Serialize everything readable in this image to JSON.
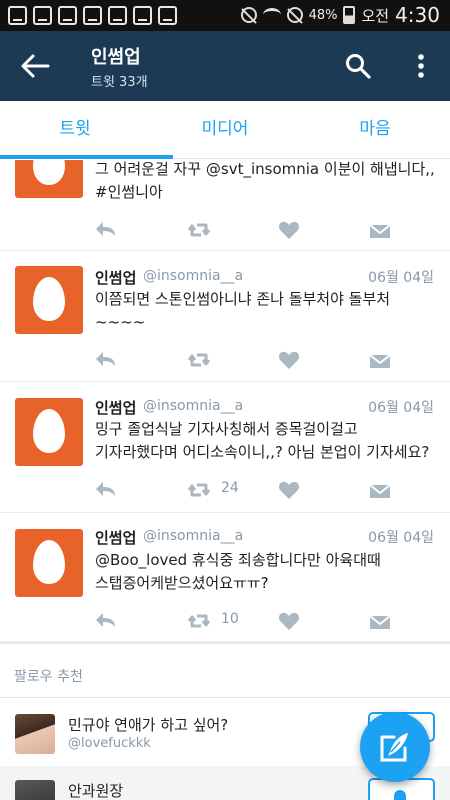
{
  "status_bar": {
    "battery": "48%",
    "ampm": "오전",
    "time": "4:30"
  },
  "header": {
    "title": "인썸업",
    "subtitle": "트윗 33개",
    "back_icon": "arrow-left-icon",
    "search_icon": "search-icon",
    "more_icon": "more-vertical-icon"
  },
  "tabs": [
    {
      "label": "트윗",
      "active": true
    },
    {
      "label": "미디어",
      "active": false
    },
    {
      "label": "마음",
      "active": false
    }
  ],
  "tweets": [
    {
      "name": "",
      "handle": "",
      "date": "",
      "text_line1": "그 어려운걸 자꾸 @svt_insomnia 이분이 해냅니다,,",
      "text_line2": "#인썸니아",
      "retweets": "",
      "partial": true
    },
    {
      "name": "인썸업",
      "handle": "@insomnia__a",
      "date": "06월 04일",
      "text_line1": "이쯤되면 스톤인썸아니냐 존나 돌부처야 돌부처~~~~",
      "text_line2": "",
      "retweets": ""
    },
    {
      "name": "인썸업",
      "handle": "@insomnia__a",
      "date": "06월 04일",
      "text_line1": "밍구 졸업식날 기자사칭해서 증목걸이걸고",
      "text_line2": "기자라했다며 어디소속이니,,? 아님 본업이 기자세요?",
      "retweets": "24"
    },
    {
      "name": "인썸업",
      "handle": "@insomnia__a",
      "date": "06월 04일",
      "text_line1": "@Boo_loved 휴식중 죄송합니다만 아육대때",
      "text_line2": "스탭증어케받으셨어요ㅠㅠ?",
      "retweets": "10"
    }
  ],
  "who_to_follow": {
    "heading": "팔로우 추천",
    "users": [
      {
        "name": "민규야 연애가 하고 싶어?",
        "handle": "@lovefuckkk"
      },
      {
        "name": "안과원장",
        "handle": ""
      }
    ]
  },
  "colors": {
    "appbar": "#1c3a54",
    "accent": "#1da1f2",
    "egg_avatar": "#e8632a",
    "action_icon": "#aab8c2"
  },
  "fab": {
    "icon": "compose-icon"
  }
}
